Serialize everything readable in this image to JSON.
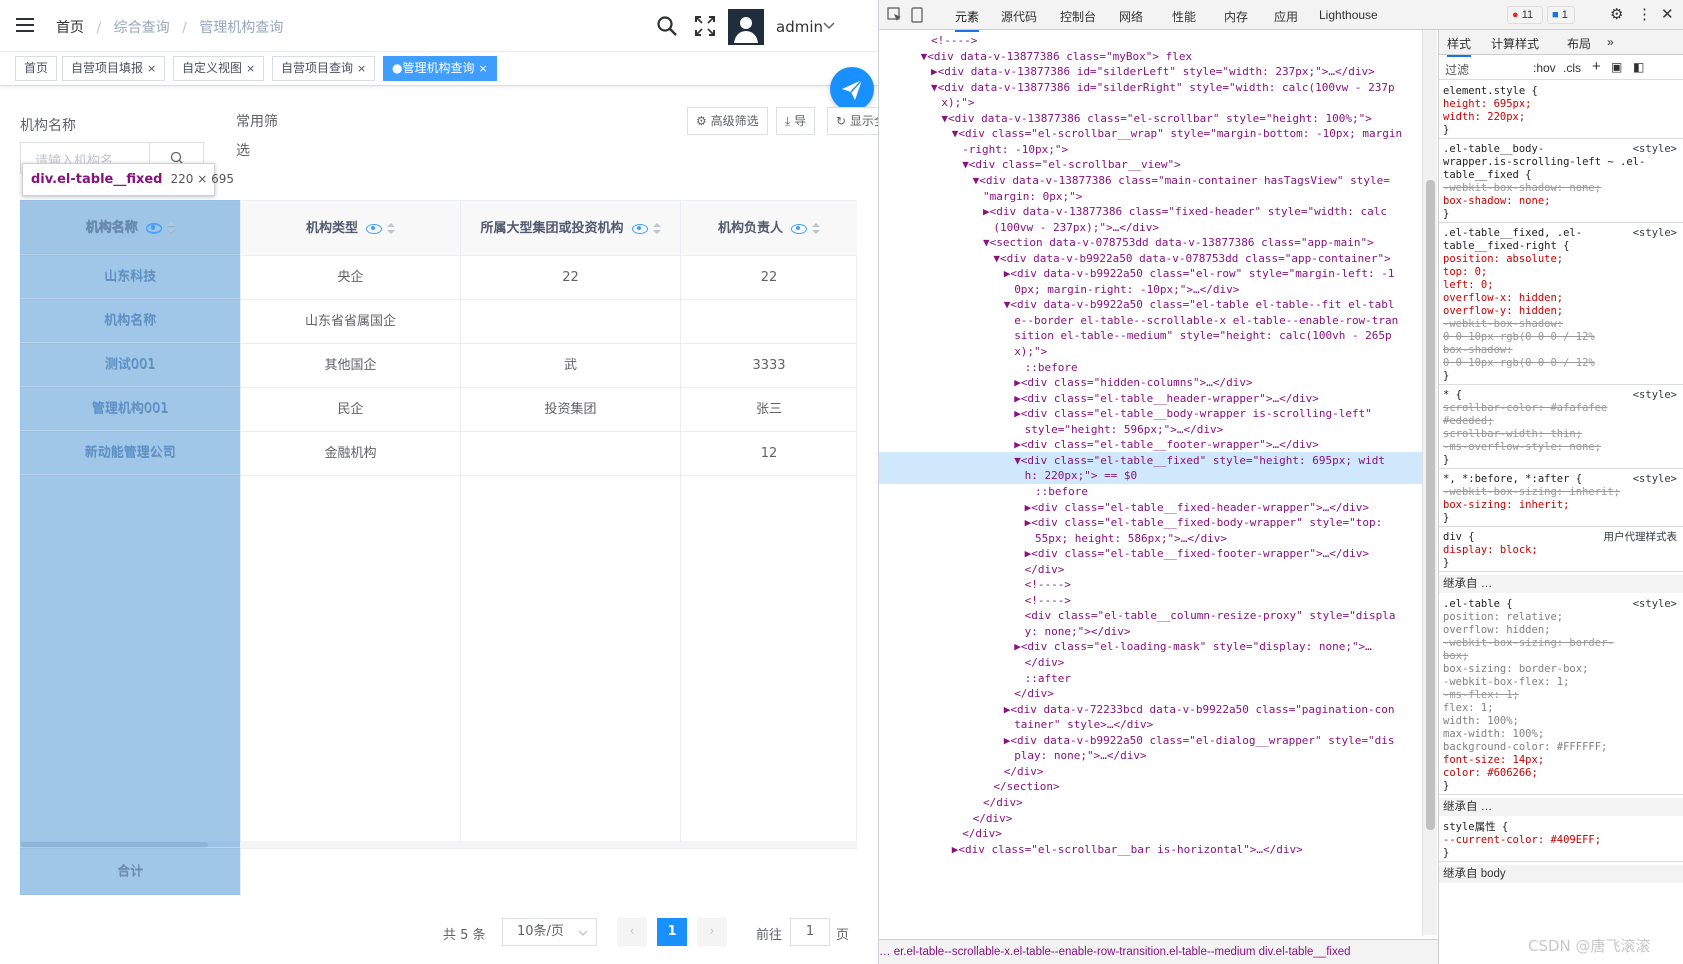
{
  "breadcrumb": {
    "home": "首页",
    "sep": "/",
    "level2": "综合查询",
    "level3": "管理机构查询"
  },
  "user": {
    "name": "admin"
  },
  "tags": [
    {
      "label": "首页",
      "close": ""
    },
    {
      "label": "自营项目填报",
      "close": "×"
    },
    {
      "label": "自定义视图",
      "close": "×"
    },
    {
      "label": "自营项目查询",
      "close": "×"
    },
    {
      "label": "●管理机构查询",
      "close": "×"
    }
  ],
  "filter": {
    "org_label": "机构名称",
    "org_placeholder": "请输入机构名",
    "common_label_1": "常用筛",
    "common_label_2": "选",
    "advanced": "高级筛选",
    "export": "导",
    "show_all": "显示全"
  },
  "inspect_tooltip": {
    "selector": "div.el-table__fixed",
    "size": "220 × 695"
  },
  "table": {
    "headers": [
      "机构名称",
      "机构类型",
      "所属大型集团或投资机构",
      "机构负责人"
    ],
    "rows": [
      [
        "山东科技",
        "央企",
        "22",
        "22"
      ],
      [
        "机构名称",
        "山东省省属国企",
        "",
        ""
      ],
      [
        "测试001",
        "其他国企",
        "武",
        "3333"
      ],
      [
        "管理机构001",
        "民企",
        "投资集团",
        "张三"
      ],
      [
        "新动能管理公司",
        "金融机构",
        "",
        "12"
      ]
    ],
    "summary": "合计"
  },
  "pagination": {
    "total": "共 5 条",
    "page_size": "10条/页",
    "current": "1",
    "goto_label": "前往",
    "goto_value": "1",
    "page_unit": "页"
  },
  "devtools": {
    "tabs": [
      "元素",
      "源代码",
      "控制台",
      "网络",
      "性能",
      "内存",
      "应用",
      "Lighthouse"
    ],
    "errors": "11",
    "messages": "1",
    "dom_lines": [
      {
        "indent": 10,
        "text": "<!---->",
        "cls": ""
      },
      {
        "indent": 8,
        "text": "▼<div data-v-13877386 class=\"myBox\"> flex",
        "cls": ""
      },
      {
        "indent": 10,
        "text": "▶<div data-v-13877386 id=\"silderLeft\" style=\"width: 237px;\">…</div>",
        "cls": ""
      },
      {
        "indent": 10,
        "text": "▼<div data-v-13877386 id=\"silderRight\" style=\"width: calc(100vw - 237p",
        "cls": ""
      },
      {
        "indent": 12,
        "text": "x);\">",
        "cls": ""
      },
      {
        "indent": 12,
        "text": "▼<div data-v-13877386 class=\"el-scrollbar\" style=\"height: 100%;\">",
        "cls": ""
      },
      {
        "indent": 14,
        "text": "▼<div class=\"el-scrollbar__wrap\" style=\"margin-bottom: -10px; margin",
        "cls": ""
      },
      {
        "indent": 16,
        "text": "-right: -10px;\">",
        "cls": ""
      },
      {
        "indent": 16,
        "text": "▼<div class=\"el-scrollbar__view\">",
        "cls": ""
      },
      {
        "indent": 18,
        "text": "▼<div data-v-13877386 class=\"main-container hasTagsView\" style=",
        "cls": ""
      },
      {
        "indent": 20,
        "text": "\"margin: 0px;\">",
        "cls": ""
      },
      {
        "indent": 20,
        "text": "▶<div data-v-13877386 class=\"fixed-header\" style=\"width: calc",
        "cls": ""
      },
      {
        "indent": 22,
        "text": "(100vw - 237px);\">…</div>",
        "cls": ""
      },
      {
        "indent": 20,
        "text": "▼<section data-v-078753dd data-v-13877386 class=\"app-main\">",
        "cls": ""
      },
      {
        "indent": 22,
        "text": "▼<div data-v-b9922a50 data-v-078753dd class=\"app-container\">",
        "cls": ""
      },
      {
        "indent": 24,
        "text": "▶<div data-v-b9922a50 class=\"el-row\" style=\"margin-left: -1",
        "cls": ""
      },
      {
        "indent": 26,
        "text": "0px; margin-right: -10px;\">…</div>",
        "cls": ""
      },
      {
        "indent": 24,
        "text": "▼<div data-v-b9922a50 class=\"el-table el-table--fit el-tabl",
        "cls": ""
      },
      {
        "indent": 26,
        "text": "e--border el-table--scrollable-x el-table--enable-row-tran",
        "cls": ""
      },
      {
        "indent": 26,
        "text": "sition el-table--medium\" style=\"height: calc(100vh - 265p",
        "cls": ""
      },
      {
        "indent": 26,
        "text": "x);\">",
        "cls": ""
      },
      {
        "indent": 28,
        "text": "::before",
        "cls": ""
      },
      {
        "indent": 26,
        "text": "▶<div class=\"hidden-columns\">…</div>",
        "cls": ""
      },
      {
        "indent": 26,
        "text": "▶<div class=\"el-table__header-wrapper\">…</div>",
        "cls": ""
      },
      {
        "indent": 26,
        "text": "▶<div class=\"el-table__body-wrapper is-scrolling-left\"",
        "cls": ""
      },
      {
        "indent": 28,
        "text": "style=\"height: 596px;\">…</div>",
        "cls": ""
      },
      {
        "indent": 26,
        "text": "▶<div class=\"el-table__footer-wrapper\">…</div>",
        "cls": ""
      },
      {
        "indent": 26,
        "text": "▼<div class=\"el-table__fixed\" style=\"height: 695px; widt",
        "cls": "sel"
      },
      {
        "indent": 28,
        "text": "h: 220px;\"> == $0",
        "cls": "sel"
      },
      {
        "indent": 30,
        "text": "::before",
        "cls": ""
      },
      {
        "indent": 28,
        "text": "▶<div class=\"el-table__fixed-header-wrapper\">…</div>",
        "cls": ""
      },
      {
        "indent": 28,
        "text": "▶<div class=\"el-table__fixed-body-wrapper\" style=\"top:",
        "cls": ""
      },
      {
        "indent": 30,
        "text": "55px; height: 586px;\">…</div>",
        "cls": ""
      },
      {
        "indent": 28,
        "text": "▶<div class=\"el-table__fixed-footer-wrapper\">…</div>",
        "cls": ""
      },
      {
        "indent": 28,
        "text": "</div>",
        "cls": ""
      },
      {
        "indent": 28,
        "text": "<!---->",
        "cls": ""
      },
      {
        "indent": 28,
        "text": "<!---->",
        "cls": ""
      },
      {
        "indent": 28,
        "text": "<div class=\"el-table__column-resize-proxy\" style=\"displa",
        "cls": ""
      },
      {
        "indent": 28,
        "text": "y: none;\"></div>",
        "cls": ""
      },
      {
        "indent": 26,
        "text": "▶<div class=\"el-loading-mask\" style=\"display: none;\">…",
        "cls": ""
      },
      {
        "indent": 28,
        "text": "</div>",
        "cls": ""
      },
      {
        "indent": 28,
        "text": "::after",
        "cls": ""
      },
      {
        "indent": 26,
        "text": "</div>",
        "cls": ""
      },
      {
        "indent": 24,
        "text": "▶<div data-v-72233bcd data-v-b9922a50 class=\"pagination-con",
        "cls": ""
      },
      {
        "indent": 26,
        "text": "tainer\" style>…</div>",
        "cls": ""
      },
      {
        "indent": 24,
        "text": "▶<div data-v-b9922a50 class=\"el-dialog__wrapper\" style=\"dis",
        "cls": ""
      },
      {
        "indent": 26,
        "text": "play: none;\">…</div>",
        "cls": ""
      },
      {
        "indent": 24,
        "text": "</div>",
        "cls": ""
      },
      {
        "indent": 22,
        "text": "</section>",
        "cls": ""
      },
      {
        "indent": 20,
        "text": "</div>",
        "cls": ""
      },
      {
        "indent": 18,
        "text": "</div>",
        "cls": ""
      },
      {
        "indent": 16,
        "text": "</div>",
        "cls": ""
      },
      {
        "indent": 14,
        "text": "▶<div class=\"el-scrollbar__bar is-horizontal\">…</div>",
        "cls": ""
      }
    ],
    "breadcrumb_bottom": "…  er.el-table--scrollable-x.el-table--enable-row-transition.el-table--medium    div.el-table__fixed",
    "style_tabs": [
      "样式",
      "计算样式",
      "布局",
      "»"
    ],
    "filter_label": "过滤",
    "hov": ":hov",
    "cls": ".cls",
    "style_lines": [
      {
        "t": "element.style {",
        "c": "",
        "src": ""
      },
      {
        "t": "  height: 695px;",
        "c": "prop",
        "src": ""
      },
      {
        "t": "  width: 220px;",
        "c": "prop",
        "src": ""
      },
      {
        "t": "}",
        "c": "",
        "src": ""
      },
      {
        "t": ".el-table__body-",
        "c": "",
        "src": "<style>"
      },
      {
        "t": "wrapper.is-scrolling-left ~ .el-",
        "c": "",
        "src": ""
      },
      {
        "t": "table__fixed {",
        "c": "",
        "src": ""
      },
      {
        "t": "  -webkit-box-shadow: none;",
        "c": "strike",
        "src": ""
      },
      {
        "t": "  box-shadow: none;",
        "c": "prop",
        "src": ""
      },
      {
        "t": "}",
        "c": "",
        "src": ""
      },
      {
        "t": ".el-table__fixed, .el-",
        "c": "",
        "src": "<style>"
      },
      {
        "t": "table__fixed-right {",
        "c": "",
        "src": ""
      },
      {
        "t": "  position: absolute;",
        "c": "prop",
        "src": ""
      },
      {
        "t": "  top: 0;",
        "c": "prop",
        "src": ""
      },
      {
        "t": "  left: 0;",
        "c": "prop",
        "src": ""
      },
      {
        "t": "  overflow-x: hidden;",
        "c": "prop",
        "src": ""
      },
      {
        "t": "  overflow-y: hidden;",
        "c": "prop",
        "src": ""
      },
      {
        "t": "  -webkit-box-shadow:",
        "c": "strike",
        "src": ""
      },
      {
        "t": "     0 0 10px  rgb(0 0 0 / 12%",
        "c": "strike",
        "src": ""
      },
      {
        "t": "  box-shadow:",
        "c": "strike",
        "src": ""
      },
      {
        "t": "     0 0 10px  rgb(0 0 0 / 12%",
        "c": "strike",
        "src": ""
      },
      {
        "t": "}",
        "c": "",
        "src": ""
      },
      {
        "t": "* {",
        "c": "",
        "src": "<style>"
      },
      {
        "t": "  scrollbar-color: #afafafee",
        "c": "strike",
        "src": ""
      },
      {
        "t": "     #ededed;",
        "c": "strike",
        "src": ""
      },
      {
        "t": "  scrollbar-width: thin;",
        "c": "strike",
        "src": ""
      },
      {
        "t": "  -ms-overflow-style: none;",
        "c": "strike",
        "src": ""
      },
      {
        "t": "}",
        "c": "",
        "src": ""
      },
      {
        "t": "*, *:before, *:after {",
        "c": "",
        "src": "<style>"
      },
      {
        "t": "  -webkit-box-sizing: inherit;",
        "c": "strike",
        "src": ""
      },
      {
        "t": "  box-sizing: inherit;",
        "c": "prop",
        "src": ""
      },
      {
        "t": "}",
        "c": "",
        "src": ""
      },
      {
        "t": "div {",
        "c": "",
        "src": "用户代理样式表"
      },
      {
        "t": "  display: block;",
        "c": "prop",
        "src": ""
      },
      {
        "t": "}",
        "c": "",
        "src": ""
      }
    ],
    "inherit_label_1": "继承自 …",
    "style_lines_2": [
      {
        "t": ".el-table {",
        "c": "",
        "src": "<style>"
      },
      {
        "t": "  position: relative;",
        "c": "grey",
        "src": ""
      },
      {
        "t": "  overflow: hidden;",
        "c": "grey",
        "src": ""
      },
      {
        "t": "  -webkit-box-sizing: border-",
        "c": "strike",
        "src": ""
      },
      {
        "t": "     box;",
        "c": "strike",
        "src": ""
      },
      {
        "t": "  box-sizing: border-box;",
        "c": "grey",
        "src": ""
      },
      {
        "t": "  -webkit-box-flex: 1;",
        "c": "grey",
        "src": ""
      },
      {
        "t": "  -ms-flex: 1;",
        "c": "strike",
        "src": ""
      },
      {
        "t": "  flex: 1;",
        "c": "grey",
        "src": ""
      },
      {
        "t": "  width: 100%;",
        "c": "grey",
        "src": ""
      },
      {
        "t": "  max-width: 100%;",
        "c": "grey",
        "src": ""
      },
      {
        "t": "  background-color: #FFFFFF;",
        "c": "grey",
        "src": ""
      },
      {
        "t": "  font-size: 14px;",
        "c": "prop",
        "src": ""
      },
      {
        "t": "  color: #606266;",
        "c": "prop",
        "src": ""
      },
      {
        "t": "}",
        "c": "",
        "src": ""
      }
    ],
    "inherit_label_2": "继承自 …",
    "style_lines_3": [
      {
        "t": "style属性 {",
        "c": "",
        "src": ""
      },
      {
        "t": "  --current-color: #409EFF;",
        "c": "prop",
        "src": ""
      },
      {
        "t": "}",
        "c": "",
        "src": ""
      }
    ],
    "inherit_label_3": "继承自 body"
  },
  "watermark": "CSDN @唐飞滚滚",
  "colors": {
    "primary": "#1890ff",
    "tag_active": "#409eff",
    "fixed_overlay": "#6fa8dc"
  }
}
